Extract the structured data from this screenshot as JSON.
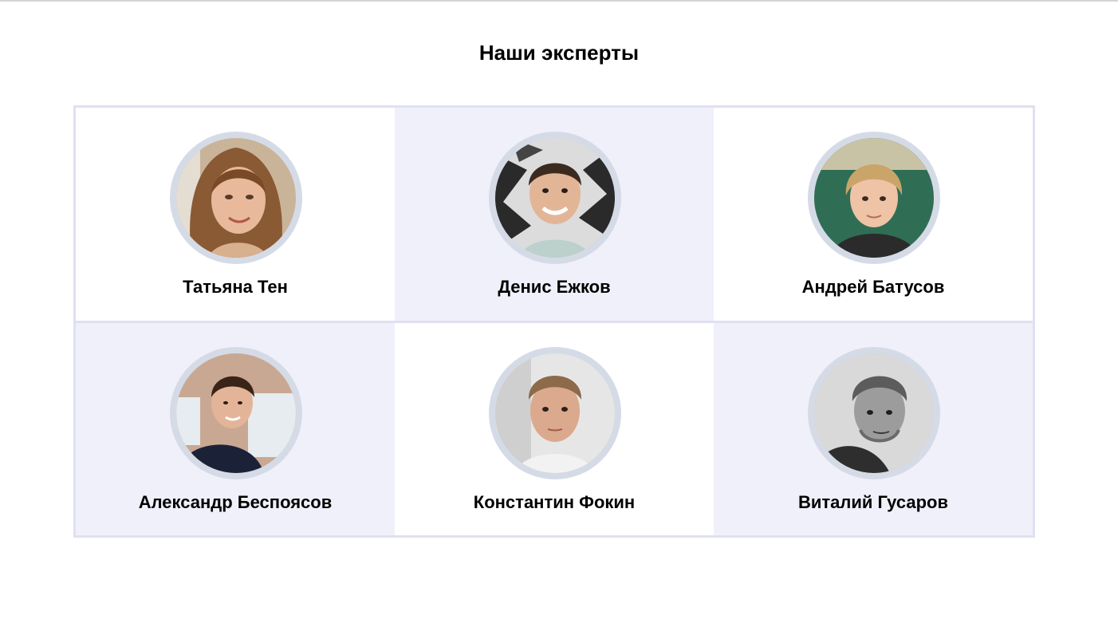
{
  "section": {
    "title": "Наши эксперты"
  },
  "experts": [
    {
      "name": "Татьяна Тен"
    },
    {
      "name": "Денис Ежков"
    },
    {
      "name": "Андрей Батусов"
    },
    {
      "name": "Александр Беспоясов"
    },
    {
      "name": "Константин Фокин"
    },
    {
      "name": "Виталий Гусаров"
    }
  ],
  "colors": {
    "grid_border": "#e0e0f2",
    "card_shade": "#f0f0fa",
    "avatar_ring": "#d5dbe6"
  }
}
